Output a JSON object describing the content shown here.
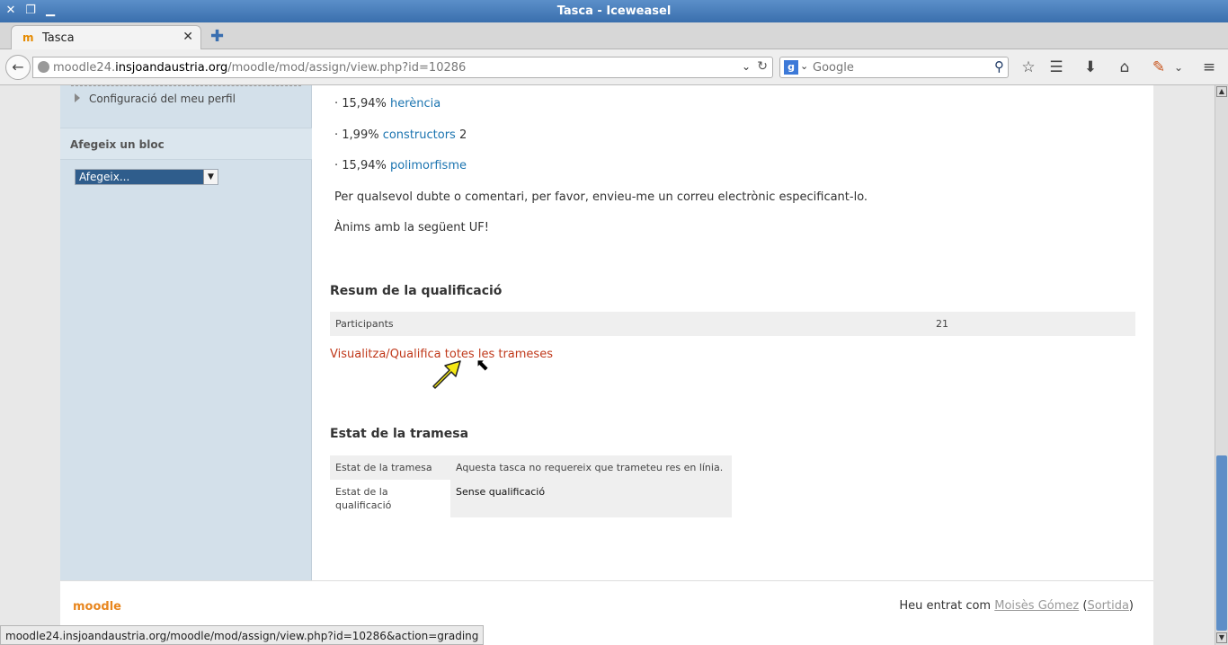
{
  "window": {
    "title": "Tasca - Iceweasel"
  },
  "tabs": [
    {
      "label": "Tasca"
    }
  ],
  "navbar": {
    "url_prefix": "moodle24.",
    "url_host": "insjoandaustria.org",
    "url_path": "/moodle/mod/assign/view.php?id=10286",
    "search_placeholder": "Google"
  },
  "sidebar": {
    "profile_item": "Configuració del meu perfil",
    "add_block_title": "Afegeix un bloc",
    "add_block_select": "Afegeix..."
  },
  "content": {
    "lines": [
      {
        "prefix": "· 15,94% ",
        "link": "herència",
        "suffix": ""
      },
      {
        "prefix": "· 1,99% ",
        "link": "constructors",
        "suffix": " 2"
      },
      {
        "prefix": "· 15,94% ",
        "link": "polimorfisme",
        "suffix": ""
      }
    ],
    "doubt_text": "Per qualsevol dubte o comentari, per favor, envieu-me un correu electrònic especificant-lo.",
    "encourage_text": "Ànims amb la següent UF!"
  },
  "grading_summary": {
    "title": "Resum de la qualificació",
    "participants_label": "Participants",
    "participants_value": "21",
    "grade_link": "Visualitza/Qualifica totes les trameses"
  },
  "submission_status": {
    "title": "Estat de la tramesa",
    "rows": [
      {
        "key": "Estat de la tramesa",
        "value": "Aquesta tasca no requereix que trameteu res en línia."
      },
      {
        "key": "Estat de la qualificació",
        "value": "Sense qualificació"
      }
    ]
  },
  "footer": {
    "logo": "moodle",
    "login_prefix": "Heu entrat com ",
    "user": "Moisès Gómez",
    "logout": "Sortida"
  },
  "statusbar": "moodle24.insjoandaustria.org/moodle/mod/assign/view.php?id=10286&action=grading",
  "colors": {
    "link": "#1b74b0",
    "grading_link": "#c0391b",
    "titlebar": "#3a6fad",
    "sidebar": "#d3e0ea"
  }
}
